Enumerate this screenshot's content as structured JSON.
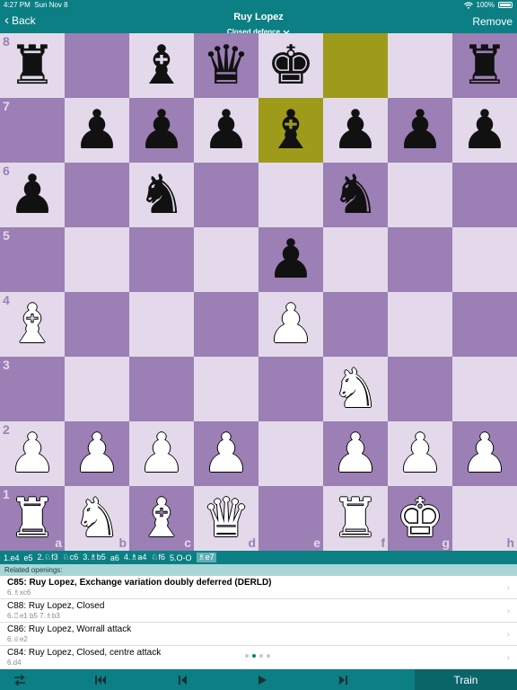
{
  "status": {
    "time": "4:27 PM",
    "date": "Sun Nov 8",
    "wifi_icon": "wifi-icon",
    "battery": "100%"
  },
  "navbar": {
    "back_label": "Back",
    "title": "Ruy Lopez",
    "subtitle": "Closed defence",
    "remove_label": "Remove"
  },
  "board": {
    "orientation": "white-bottom",
    "light_color": "#e3d9ea",
    "dark_color": "#9b7fb5",
    "highlight_color": "#9f9b1a",
    "highlighted_squares": [
      "f8",
      "e7"
    ],
    "rank_labels": [
      "8",
      "7",
      "6",
      "5",
      "4",
      "3",
      "2",
      "1"
    ],
    "file_labels": [
      "a",
      "b",
      "c",
      "d",
      "e",
      "f",
      "g",
      "h"
    ],
    "rows": [
      [
        "bR",
        "",
        "bB",
        "bQ",
        "bK",
        "",
        "",
        "bR"
      ],
      [
        "",
        "bP",
        "bP",
        "bP",
        "bB",
        "bP",
        "bP",
        "bP"
      ],
      [
        "bP",
        "",
        "bN",
        "",
        "",
        "bN",
        "",
        ""
      ],
      [
        "",
        "",
        "",
        "",
        "bP",
        "",
        "",
        ""
      ],
      [
        "wB",
        "",
        "",
        "",
        "wP",
        "",
        "",
        ""
      ],
      [
        "",
        "",
        "",
        "",
        "",
        "wN",
        "",
        ""
      ],
      [
        "wP",
        "wP",
        "wP",
        "wP",
        "",
        "wP",
        "wP",
        "wP"
      ],
      [
        "wR",
        "wN",
        "wB",
        "wQ",
        "",
        "wR",
        "wK",
        ""
      ]
    ]
  },
  "move_list": [
    "1.e4",
    "e5",
    "2.♘f3",
    "♘c6",
    "3.♗b5",
    "a6",
    "4.♗a4",
    "♘f6",
    "5.O-O",
    "♗e7"
  ],
  "current_move_index": 9,
  "related": {
    "header": "Related openings:",
    "items": [
      {
        "name": "C85: Ruy Lopez, Exchange variation doubly deferred (DERLD)",
        "moves": "6.♗xc6",
        "bold": true
      },
      {
        "name": "C88: Ruy Lopez, Closed",
        "moves": "6.♖e1 b5 7.♗b3",
        "bold": false
      },
      {
        "name": "C86: Ruy Lopez, Worrall attack",
        "moves": "6.♕e2",
        "bold": false
      },
      {
        "name": "C84: Ruy Lopez, Closed, centre attack",
        "moves": "6.d4",
        "bold": false
      }
    ],
    "page_count": 4,
    "page_index": 1
  },
  "toolbar": {
    "flip_icon": "flip-board-icon",
    "first_icon": "first-move-icon",
    "prev_icon": "previous-move-icon",
    "play_icon": "play-icon",
    "last_icon": "last-move-icon",
    "train_label": "Train"
  }
}
